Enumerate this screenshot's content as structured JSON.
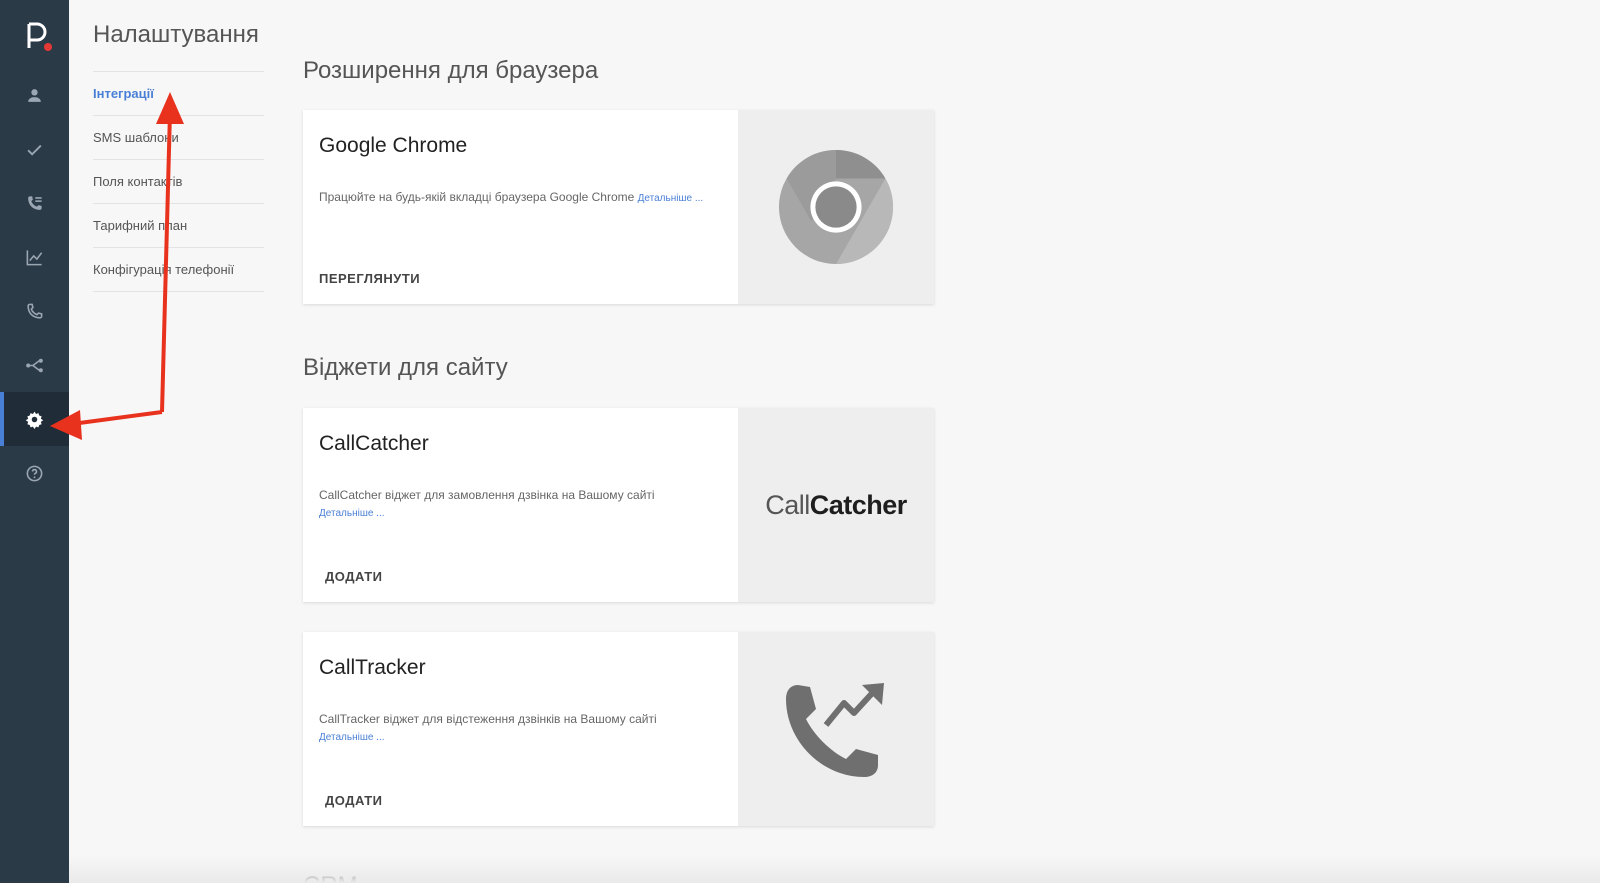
{
  "sidebar": {
    "items": [
      {
        "icon": "person-icon"
      },
      {
        "icon": "check-icon"
      },
      {
        "icon": "call-list-icon"
      },
      {
        "icon": "chart-icon"
      },
      {
        "icon": "phone-icon"
      },
      {
        "icon": "share-icon"
      },
      {
        "icon": "gear-icon",
        "active": true
      },
      {
        "icon": "help-icon"
      }
    ],
    "accent_color": "#4a7fd6",
    "logo_dot_color": "#e53935"
  },
  "page": {
    "title": "Налаштування"
  },
  "subnav": {
    "items": [
      {
        "label": "Інтеграції",
        "active": true
      },
      {
        "label": "SMS шаблони"
      },
      {
        "label": "Поля контактів"
      },
      {
        "label": "Тарифний план"
      },
      {
        "label": "Конфігурація телефонії"
      }
    ]
  },
  "sections": {
    "browser": {
      "title": "Розширення для браузера",
      "cards": [
        {
          "title": "Google Chrome",
          "description": "Працюйте на будь-якій вкладці браузера Google Chrome",
          "more_link": "Детальніше ...",
          "action": "ПЕРЕГЛЯНУТИ",
          "icon": "chrome-icon"
        }
      ]
    },
    "widgets": {
      "title": "Віджети для сайту",
      "cards": [
        {
          "title": "CallCatcher",
          "description": "CallCatcher віджет для замовлення дзвінка на Вашому сайті",
          "more_link": "Детальніше ...",
          "action": "ДОДАТИ",
          "logo_part1": "Call",
          "logo_part2": "Catcher"
        },
        {
          "title": "CallTracker",
          "description": "CallTracker віджет для відстеження дзвінків на Вашому сайті",
          "more_link": "Детальніше ...",
          "action": "ДОДАТИ",
          "icon": "phone-trend-icon"
        }
      ]
    },
    "crm": {
      "title": "CRM"
    }
  },
  "annotation_color": "#e8321e"
}
